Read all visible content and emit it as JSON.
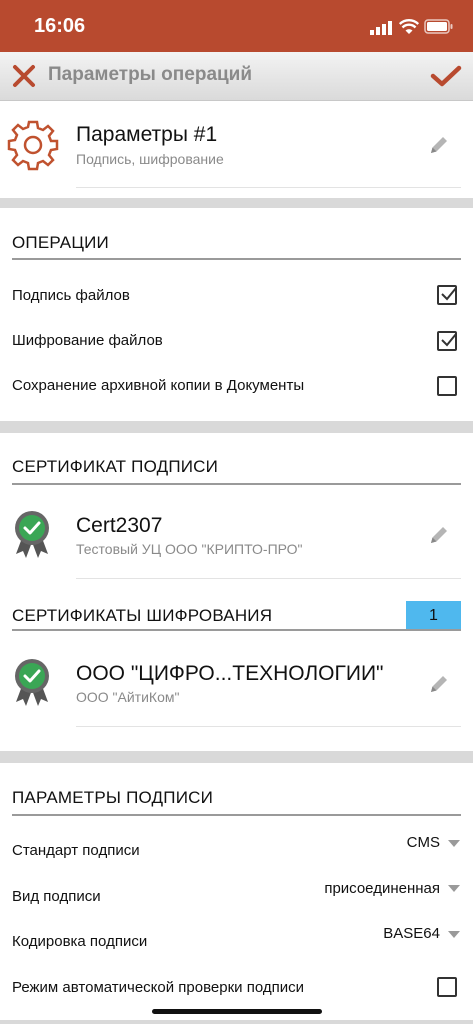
{
  "status": {
    "time": "16:06"
  },
  "toolbar": {
    "title": "Параметры операций"
  },
  "profile": {
    "title": "Параметры #1",
    "subtitle": "Подпись, шифрование"
  },
  "operations": {
    "header": "ОПЕРАЦИИ",
    "items": [
      {
        "label": "Подпись файлов",
        "checked": true
      },
      {
        "label": "Шифрование файлов",
        "checked": true
      },
      {
        "label": "Сохранение архивной копии в Документы",
        "checked": false
      }
    ]
  },
  "sign_cert": {
    "header": "СЕРТИФИКАТ ПОДПИСИ",
    "name": "Cert2307",
    "issuer": "Тестовый УЦ ООО \"КРИПТО-ПРО\""
  },
  "enc_certs": {
    "header": "СЕРТИФИКАТЫ ШИФРОВАНИЯ",
    "count": "1",
    "name": "ООО \"ЦИФРО...ТЕХНОЛОГИИ\"",
    "issuer": "ООО \"АйтиКом\""
  },
  "sign_params": {
    "header": "ПАРАМЕТРЫ ПОДПИСИ",
    "standard_label": "Стандарт подписи",
    "standard_value": "CMS",
    "type_label": "Вид подписи",
    "type_value": "присоединенная",
    "encoding_label": "Кодировка подписи",
    "encoding_value": "BASE64",
    "autocheck_label": "Режим автоматической проверки подписи",
    "autocheck_checked": false
  },
  "colors": {
    "accent": "#b84a2f",
    "badge": "#4fb8ee",
    "cert_green": "#3aa655"
  }
}
